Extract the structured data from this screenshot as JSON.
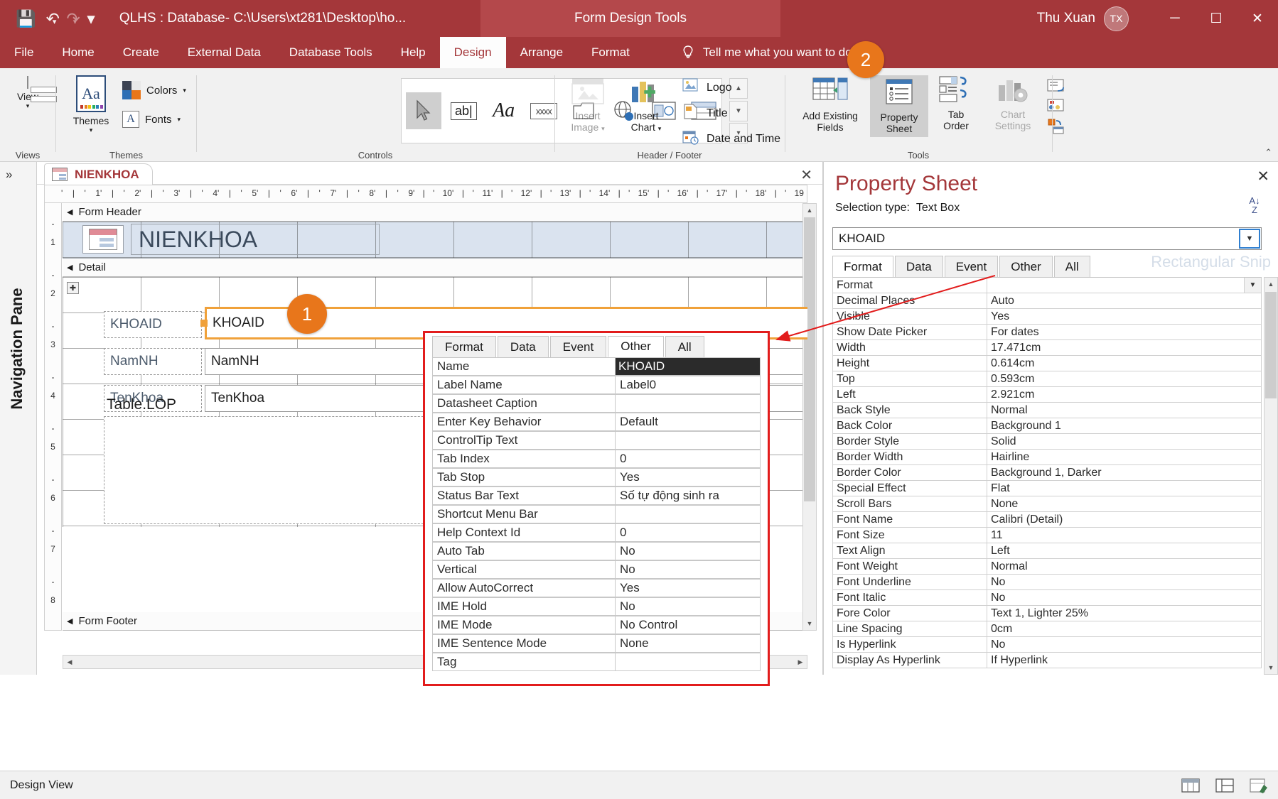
{
  "titlebar": {
    "save_icon": "save-icon",
    "undo_icon": "undo-icon",
    "redo_icon": "redo-icon",
    "customize_icon": "customize-quick-access-icon",
    "window_title": "QLHS : Database- C:\\Users\\xt281\\Desktop\\ho...",
    "contextual_tab_title": "Form Design Tools",
    "user_name": "Thu Xuan",
    "user_initials": "TX",
    "minimize": "─",
    "maximize": "☐",
    "close": "✕"
  },
  "ribbon_tabs": [
    {
      "label": "File",
      "active": false
    },
    {
      "label": "Home",
      "active": false
    },
    {
      "label": "Create",
      "active": false
    },
    {
      "label": "External Data",
      "active": false
    },
    {
      "label": "Database Tools",
      "active": false
    },
    {
      "label": "Help",
      "active": false
    },
    {
      "label": "Design",
      "active": true
    },
    {
      "label": "Arrange",
      "active": false
    },
    {
      "label": "Format",
      "active": false
    }
  ],
  "tell_me": "Tell me what you want to do",
  "ribbon": {
    "groups": [
      {
        "label": "Views"
      },
      {
        "label": "Themes"
      },
      {
        "label": "Controls"
      },
      {
        "label": "Header / Footer"
      },
      {
        "label": "Tools"
      }
    ],
    "view_button": "View",
    "themes_button": "Themes",
    "colors_button": "Colors",
    "fonts_button": "Fonts",
    "insert_image_button": "Insert\nImage",
    "insert_image_line1": "Insert",
    "insert_image_line2": "Image",
    "insert_chart_line1": "Insert",
    "insert_chart_line2": "Chart",
    "logo_button": "Logo",
    "title_button": "Title",
    "date_time_button": "Date and Time",
    "add_existing_fields_line1": "Add Existing",
    "add_existing_fields_line2": "Fields",
    "property_sheet_line1": "Property",
    "property_sheet_line2": "Sheet",
    "tab_order_line1": "Tab",
    "tab_order_line2": "Order",
    "chart_settings_line1": "Chart",
    "chart_settings_line2": "Settings",
    "collapse_caret": "⌃",
    "accent_color": "#a4373a"
  },
  "callouts": [
    {
      "number": "1"
    },
    {
      "number": "2"
    }
  ],
  "navigation_pane": {
    "label": "Navigation Pane",
    "expand_icon": "»"
  },
  "document": {
    "tab_label": "NIENKHOA",
    "close_label": "✕",
    "hruler_ticks": [
      "1",
      "2",
      "3",
      "4",
      "5",
      "6",
      "7",
      "8",
      "9",
      "10",
      "11",
      "12",
      "13",
      "14",
      "15",
      "16",
      "17",
      "18",
      "19"
    ],
    "vruler_ticks": [
      "1",
      "2",
      "3",
      "4",
      "5",
      "6",
      "7",
      "8"
    ],
    "sections": {
      "form_header": "Form Header",
      "detail": "Detail",
      "form_footer": "Form Footer"
    },
    "header_title": "NIENKHOA",
    "fields": [
      {
        "label": "KHOAID",
        "value": "KHOAID",
        "selected": true
      },
      {
        "label": "NamNH",
        "value": "NamNH",
        "selected": false
      },
      {
        "label": "TenKhoa",
        "value": "TenKhoa",
        "selected": false
      }
    ],
    "subform_label": "Table.LOP"
  },
  "other_panel": {
    "tabs": [
      {
        "label": "Format",
        "active": false
      },
      {
        "label": "Data",
        "active": false
      },
      {
        "label": "Event",
        "active": false
      },
      {
        "label": "Other",
        "active": true
      },
      {
        "label": "All",
        "active": false
      }
    ],
    "rows": [
      {
        "key": "Name",
        "value": "KHOAID",
        "highlight": true
      },
      {
        "key": "Label Name",
        "value": "Label0",
        "highlight": false
      },
      {
        "key": "Datasheet Caption",
        "value": "",
        "highlight": false
      },
      {
        "key": "Enter Key Behavior",
        "value": "Default",
        "highlight": false
      },
      {
        "key": "ControlTip Text",
        "value": "",
        "highlight": false
      },
      {
        "key": "Tab Index",
        "value": "0",
        "highlight": false
      },
      {
        "key": "Tab Stop",
        "value": "Yes",
        "highlight": false
      },
      {
        "key": "Status Bar Text",
        "value": "Số tự động sinh ra",
        "highlight": false
      },
      {
        "key": "Shortcut Menu Bar",
        "value": "",
        "highlight": false
      },
      {
        "key": "Help Context Id",
        "value": "0",
        "highlight": false
      },
      {
        "key": "Auto Tab",
        "value": "No",
        "highlight": false
      },
      {
        "key": "Vertical",
        "value": "No",
        "highlight": false
      },
      {
        "key": "Allow AutoCorrect",
        "value": "Yes",
        "highlight": false
      },
      {
        "key": "IME Hold",
        "value": "No",
        "highlight": false
      },
      {
        "key": "IME Mode",
        "value": "No Control",
        "highlight": false
      },
      {
        "key": "IME Sentence Mode",
        "value": "None",
        "highlight": false
      },
      {
        "key": "Tag",
        "value": "",
        "highlight": false
      }
    ]
  },
  "property_sheet": {
    "title": "Property Sheet",
    "selection_type_label": "Selection type:",
    "selection_type_value": "Text Box",
    "close_label": "✕",
    "sort_icon": "sort-az-icon",
    "sort_a": "A",
    "sort_z": "Z",
    "selected_object": "KHOAID",
    "watermark": "Rectangular Snip",
    "tabs": [
      {
        "label": "Format",
        "active": true
      },
      {
        "label": "Data",
        "active": false
      },
      {
        "label": "Event",
        "active": false
      },
      {
        "label": "Other",
        "active": false
      },
      {
        "label": "All",
        "active": false
      }
    ],
    "rows": [
      {
        "key": "Format",
        "value": "",
        "dropdown": true
      },
      {
        "key": "Decimal Places",
        "value": "Auto",
        "dropdown": false
      },
      {
        "key": "Visible",
        "value": "Yes",
        "dropdown": false
      },
      {
        "key": "Show Date Picker",
        "value": "For dates",
        "dropdown": false
      },
      {
        "key": "Width",
        "value": "17.471cm",
        "dropdown": false
      },
      {
        "key": "Height",
        "value": "0.614cm",
        "dropdown": false
      },
      {
        "key": "Top",
        "value": "0.593cm",
        "dropdown": false
      },
      {
        "key": "Left",
        "value": "2.921cm",
        "dropdown": false
      },
      {
        "key": "Back Style",
        "value": "Normal",
        "dropdown": false
      },
      {
        "key": "Back Color",
        "value": "Background 1",
        "dropdown": false
      },
      {
        "key": "Border Style",
        "value": "Solid",
        "dropdown": false
      },
      {
        "key": "Border Width",
        "value": "Hairline",
        "dropdown": false
      },
      {
        "key": "Border Color",
        "value": "Background 1, Darker",
        "dropdown": false
      },
      {
        "key": "Special Effect",
        "value": "Flat",
        "dropdown": false
      },
      {
        "key": "Scroll Bars",
        "value": "None",
        "dropdown": false
      },
      {
        "key": "Font Name",
        "value": "Calibri (Detail)",
        "dropdown": false
      },
      {
        "key": "Font Size",
        "value": "11",
        "dropdown": false
      },
      {
        "key": "Text Align",
        "value": "Left",
        "dropdown": false
      },
      {
        "key": "Font Weight",
        "value": "Normal",
        "dropdown": false
      },
      {
        "key": "Font Underline",
        "value": "No",
        "dropdown": false
      },
      {
        "key": "Font Italic",
        "value": "No",
        "dropdown": false
      },
      {
        "key": "Fore Color",
        "value": "Text 1, Lighter 25%",
        "dropdown": false
      },
      {
        "key": "Line Spacing",
        "value": "0cm",
        "dropdown": false
      },
      {
        "key": "Is Hyperlink",
        "value": "No",
        "dropdown": false
      },
      {
        "key": "Display As Hyperlink",
        "value": "If Hyperlink",
        "dropdown": false
      }
    ]
  },
  "statusbar": {
    "text": "Design View",
    "view_icons": [
      "datasheet-view-icon",
      "layout-view-icon",
      "design-view-icon"
    ]
  }
}
